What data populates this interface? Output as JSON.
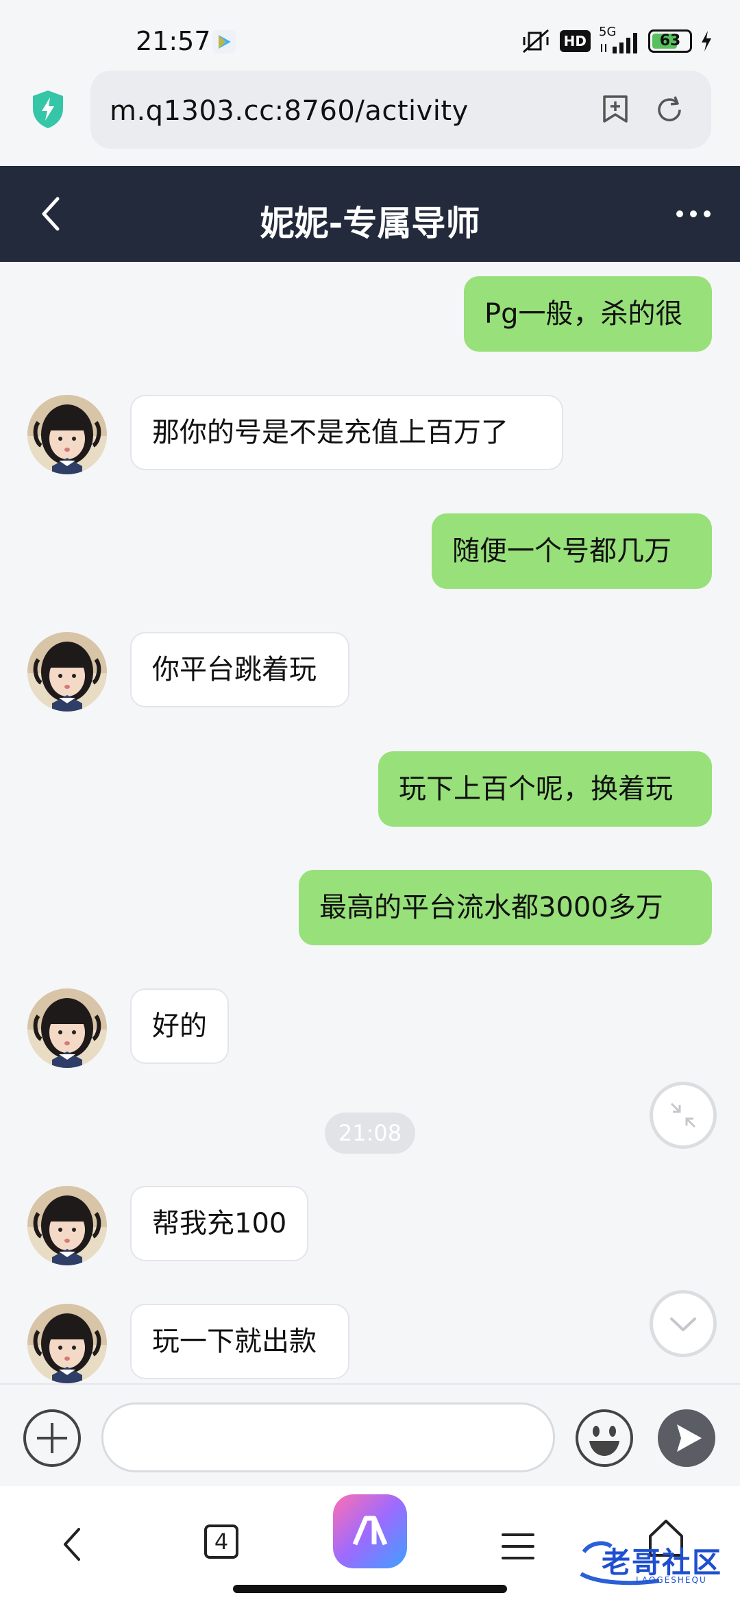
{
  "status_bar": {
    "time": "21:57",
    "network": "5G",
    "hd": "HD",
    "battery": "63"
  },
  "browser": {
    "url": "m.q1303.cc:8760/activity",
    "tabs_count": "4"
  },
  "chat": {
    "title": "妮妮-专属导师",
    "messages": [
      {
        "from": "me",
        "text": "Pg一般，杀的很"
      },
      {
        "from": "other",
        "text": "那你的号是不是充值上百万了"
      },
      {
        "from": "me",
        "text": "随便一个号都几万"
      },
      {
        "from": "other",
        "text": "你平台跳着玩"
      },
      {
        "from": "me",
        "text": "玩下上百个呢，换着玩"
      },
      {
        "from": "me",
        "text": "最高的平台流水都3000多万"
      },
      {
        "from": "other",
        "text": "好的"
      },
      {
        "from": "other",
        "text": "帮我充100"
      },
      {
        "from": "other",
        "text": "玩一下就出款"
      }
    ],
    "timestamp": "21:08"
  },
  "watermark": {
    "text": "老哥社区",
    "subtext": "LAOGESHEQU"
  },
  "colors": {
    "me_bubble": "#97e07a",
    "title_bar": "#232a3b",
    "background": "#f5f6f8"
  }
}
